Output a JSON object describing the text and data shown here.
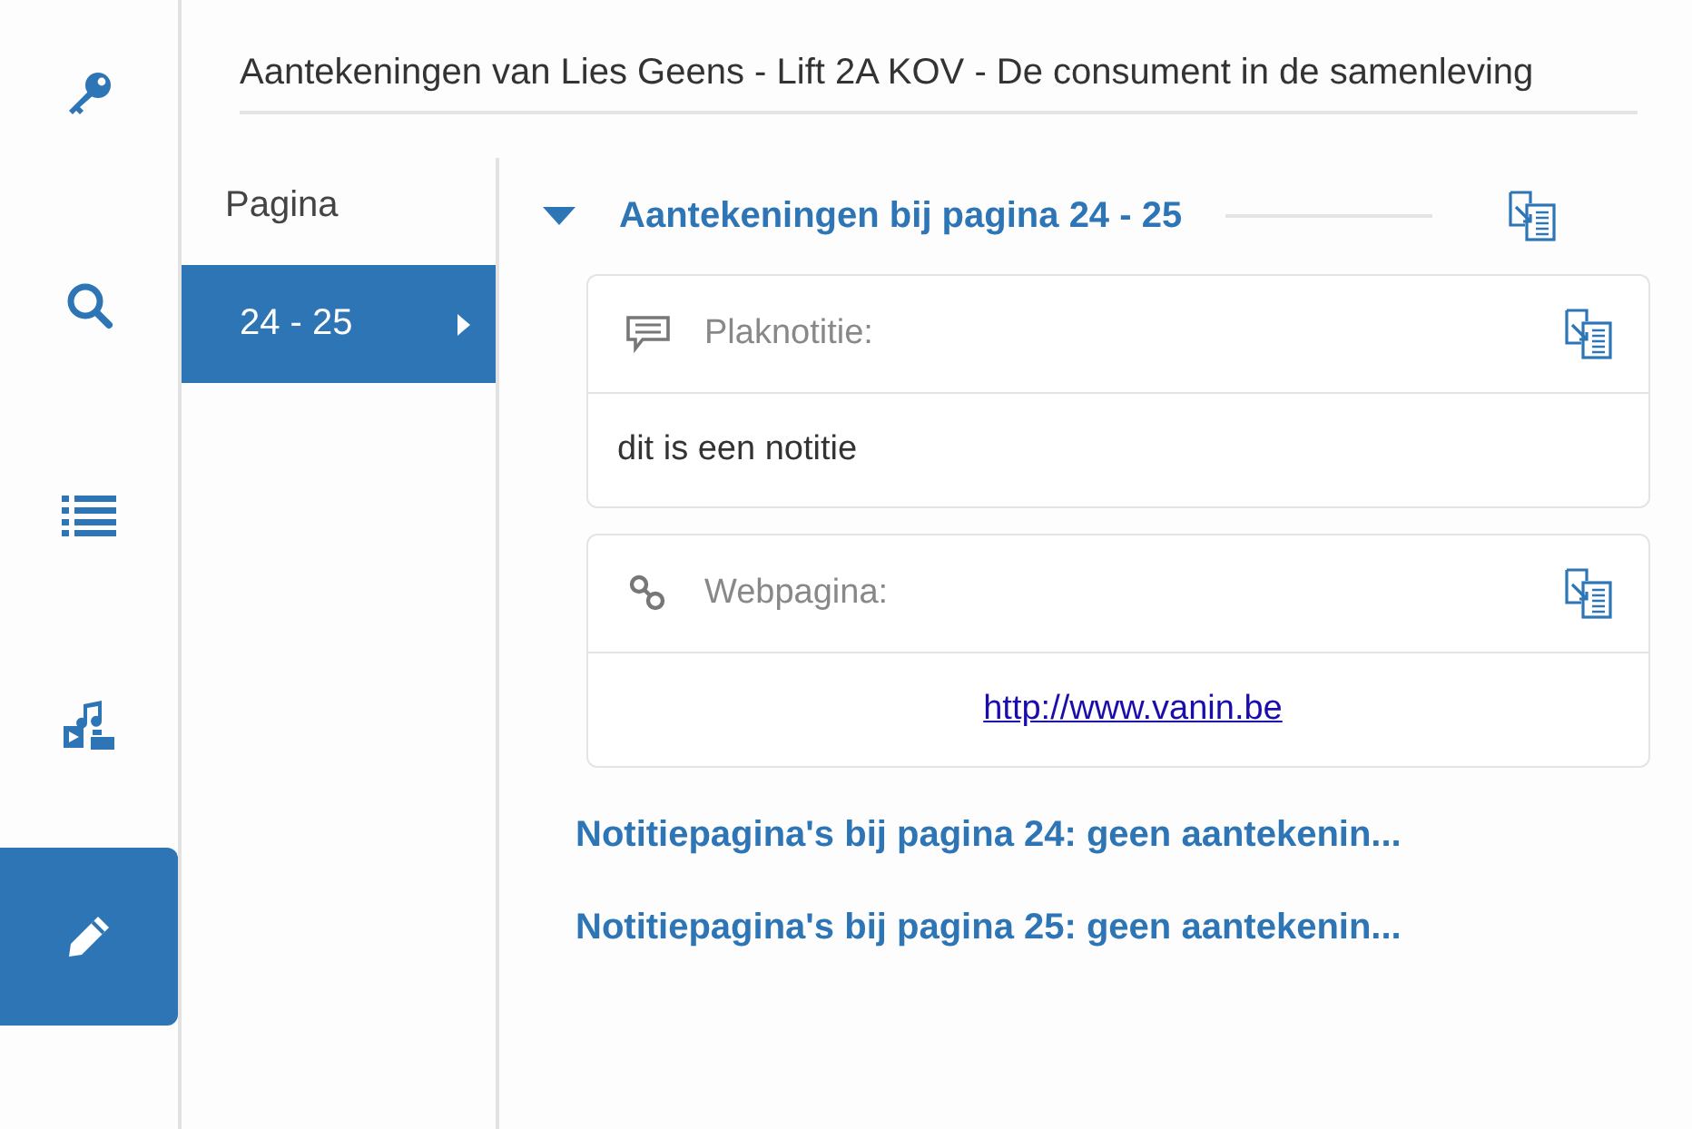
{
  "sidebar": {
    "items": [
      {
        "selected": false
      },
      {
        "selected": false
      },
      {
        "selected": false
      },
      {
        "selected": false
      },
      {
        "selected": true
      }
    ]
  },
  "title": "Aantekeningen van Lies Geens - Lift 2A KOV - De consument in de samenleving",
  "pages": {
    "heading": "Pagina",
    "items": [
      {
        "label": "24 - 25",
        "selected": true
      }
    ]
  },
  "section": {
    "heading": "Aantekeningen bij pagina 24 - 25",
    "expanded": true,
    "notes": [
      {
        "kind": "sticky",
        "label": "Plaknotitie:",
        "text": "dit is een notitie"
      },
      {
        "kind": "link",
        "label": "Webpagina:",
        "text": "http://www.vanin.be"
      }
    ]
  },
  "note_pages": [
    "Notitiepagina's bij pagina 24: geen aantekenin...",
    "Notitiepagina's bij pagina 25: geen aantekenin..."
  ]
}
